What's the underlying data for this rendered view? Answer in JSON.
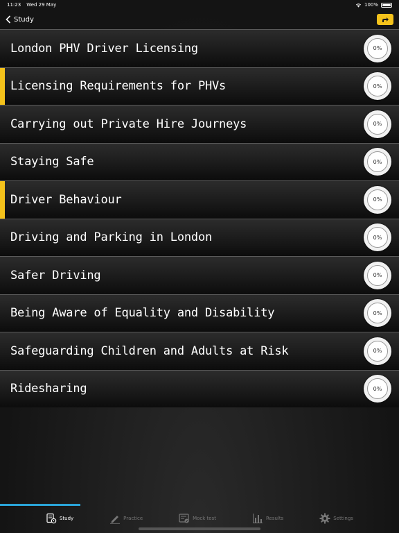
{
  "status": {
    "time": "11:23",
    "date": "Wed 29 May",
    "battery": "100%"
  },
  "nav": {
    "back_label": "Study"
  },
  "topics": [
    {
      "title": "London PHV Driver Licensing",
      "progress": "0%",
      "highlight": false
    },
    {
      "title": "Licensing Requirements for PHVs",
      "progress": "0%",
      "highlight": true
    },
    {
      "title": "Carrying out Private Hire Journeys",
      "progress": "0%",
      "highlight": false
    },
    {
      "title": "Staying Safe",
      "progress": "0%",
      "highlight": false
    },
    {
      "title": "Driver Behaviour",
      "progress": "0%",
      "highlight": true
    },
    {
      "title": "Driving and Parking in London",
      "progress": "0%",
      "highlight": false
    },
    {
      "title": "Safer Driving",
      "progress": "0%",
      "highlight": false
    },
    {
      "title": "Being Aware of Equality and Disability",
      "progress": "0%",
      "highlight": false
    },
    {
      "title": "Safeguarding Children and Adults at Risk",
      "progress": "0%",
      "highlight": false
    },
    {
      "title": "Ridesharing",
      "progress": "0%",
      "highlight": false
    }
  ],
  "tabs": [
    {
      "label": "Study",
      "icon": "study-icon",
      "active": true
    },
    {
      "label": "Practice",
      "icon": "pencil-icon",
      "active": false
    },
    {
      "label": "Mock test",
      "icon": "mock-test-icon",
      "active": false
    },
    {
      "label": "Results",
      "icon": "bar-chart-icon",
      "active": false
    },
    {
      "label": "Settings",
      "icon": "gear-icon",
      "active": false
    }
  ],
  "colors": {
    "accent": "#f4c21b",
    "tab_indicator": "#2aa4d8"
  }
}
